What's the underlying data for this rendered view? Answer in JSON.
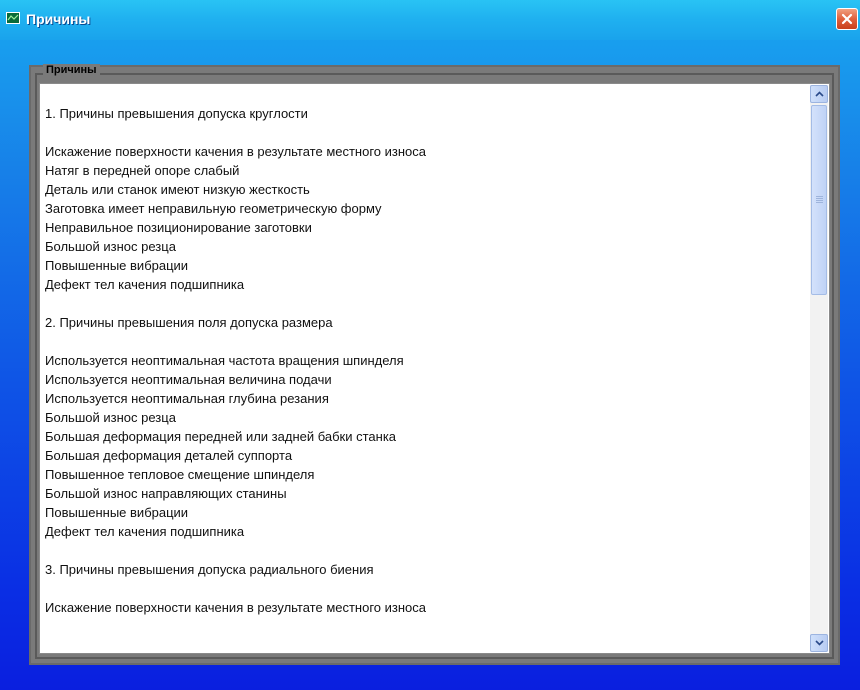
{
  "window": {
    "title": "Причины",
    "accent": "#1a8ff0",
    "close_color": "#e0603c"
  },
  "group": {
    "label": "Причины"
  },
  "lines": [
    "1. Причины превышения допуска круглости",
    "",
    "Искажение поверхности качения в результате местного износа",
    "Натяг в передней опоре слабый",
    "Деталь или станок имеют низкую жесткость",
    "Заготовка имеет неправильную геометрическую форму",
    "Неправильное позиционирование заготовки",
    "Большой износ резца",
    "Повышенные вибрации",
    "Дефект тел качения подшипника",
    "",
    "2. Причины превышения поля допуска размера",
    "",
    "Используется неоптимальная частота вращения шпинделя",
    "Используется неоптимальная величина подачи",
    "Используется неоптимальная глубина резания",
    "Большой износ резца",
    "Большая деформация передней или задней бабки станка",
    "Большая деформация деталей суппорта",
    "Повышенное тепловое смещение шпинделя",
    "Большой износ направляющих станины",
    "Повышенные вибрации",
    "Дефект тел качения подшипника",
    "",
    "3. Причины превышения допуска радиального биения",
    "",
    "Искажение поверхности качения в результате местного износа"
  ],
  "icons": {
    "app": "chart-window-icon",
    "close": "close-icon",
    "scroll_up": "chevron-up-icon",
    "scroll_down": "chevron-down-icon"
  }
}
